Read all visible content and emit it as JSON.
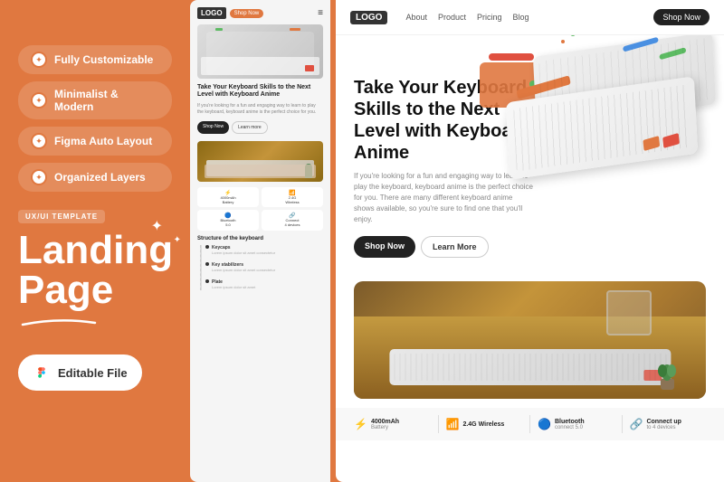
{
  "background_color": "#E07840",
  "left_panel": {
    "features": [
      {
        "id": "fully-customizable",
        "text": "Fully Customizable",
        "icon": "✦"
      },
      {
        "id": "minimalist-modern",
        "text": "Minimalist & Modern",
        "icon": "✦"
      },
      {
        "id": "figma-auto-layout",
        "text": "Figma Auto Layout",
        "icon": "✦"
      },
      {
        "id": "organized-layers",
        "text": "Organized Layers",
        "icon": "✦"
      }
    ],
    "badge": "UX/UI TEMPLATE",
    "title_line1": "Landing",
    "title_line2": "Page",
    "editable_btn": "Editable File"
  },
  "small_preview": {
    "logo": "LOGO",
    "nav_btn": "Shop Now",
    "hero_title": "Take Your Keyboard Skills to the Next Level with Keyboard Anime",
    "hero_body": "If you're looking for a fun and engaging way to learn to play the keyboard, keyboard anime is the perfect choice for you.",
    "btn_primary": "Shop Now",
    "btn_secondary": "Learn more",
    "specs": [
      {
        "icon": "⚡",
        "value": "4000mAh",
        "label": "Battery"
      },
      {
        "icon": "📶",
        "value": "2.4G",
        "label": "Wireless"
      },
      {
        "icon": "🔵",
        "value": "Bluetooth",
        "label": "Connect 5.0"
      },
      {
        "icon": "🔗",
        "value": "Connect up",
        "label": "to 4 devices"
      }
    ],
    "section_title": "Structure of the keyboard",
    "timeline": [
      {
        "title": "Keycaps",
        "body": "Lorem ipsum dolor sit amet consectetur"
      },
      {
        "title": "Key stabilizers",
        "body": "Lorem ipsum dolor sit amet consectetur"
      },
      {
        "title": "Plate",
        "body": "Lorem ipsum dolor sit amet"
      }
    ]
  },
  "large_preview": {
    "logo": "LOGO",
    "nav_links": [
      "About",
      "Product",
      "Pricing",
      "Blog"
    ],
    "nav_btn": "Shop Now",
    "hero_title": "Take Your Keyboard Skills to the Next Level with Keyboard Anime",
    "hero_body": "If you're looking for a fun and engaging way to learn to play the keyboard, keyboard anime is the perfect choice for you. There are many different keyboard anime shows available, so you're sure to find one that you'll enjoy.",
    "btn_primary": "Shop Now",
    "btn_secondary": "Learn More",
    "specs": [
      {
        "icon": "⚡",
        "value": "4000mAh",
        "label": "Battery"
      },
      {
        "icon": "📶",
        "value": "2.4G Wireless",
        "label": ""
      },
      {
        "icon": "🔵",
        "value": "Bluetooth",
        "label": "connect 5.0"
      },
      {
        "icon": "🔗",
        "value": "Connect up",
        "label": "to 4 devices"
      }
    ]
  },
  "colors": {
    "orange": "#E07840",
    "dark": "#222222",
    "blue": "#4A90E2",
    "green": "#5DBB63",
    "red": "#E05040"
  }
}
